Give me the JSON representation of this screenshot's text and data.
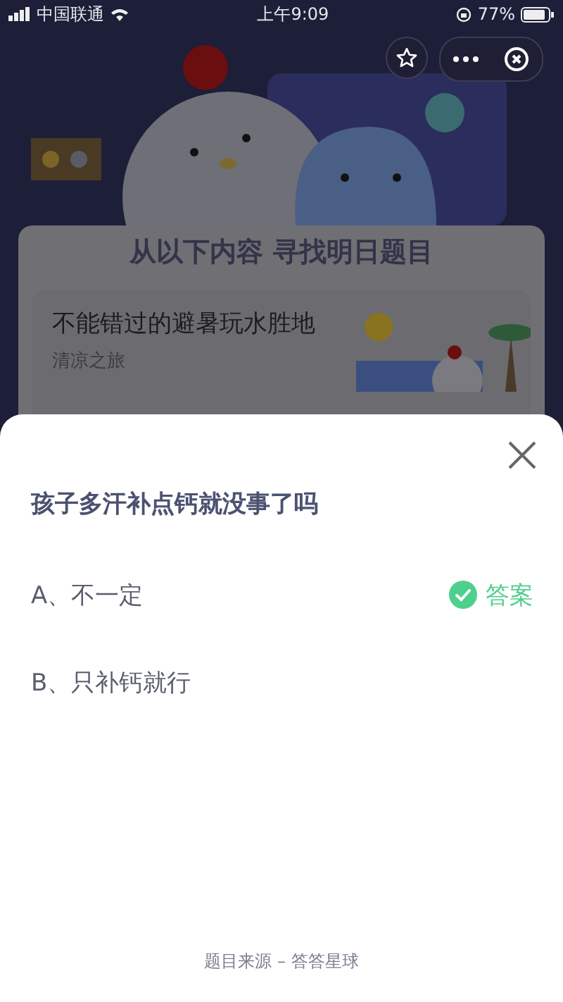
{
  "status_bar": {
    "carrier": "中国联通",
    "time": "上午9:09",
    "battery": "77%"
  },
  "banner": {
    "title": "从以下内容  寻找明日题目"
  },
  "article": {
    "title": "不能错过的避暑玩水胜地",
    "subtitle": "清凉之旅"
  },
  "sheet": {
    "question": "孩子多汗补点钙就没事了吗",
    "answer_label": "答案",
    "options": [
      {
        "label": "A、不一定",
        "correct": true
      },
      {
        "label": "B、只补钙就行",
        "correct": false
      }
    ],
    "footer": "题目来源 – 答答星球"
  }
}
